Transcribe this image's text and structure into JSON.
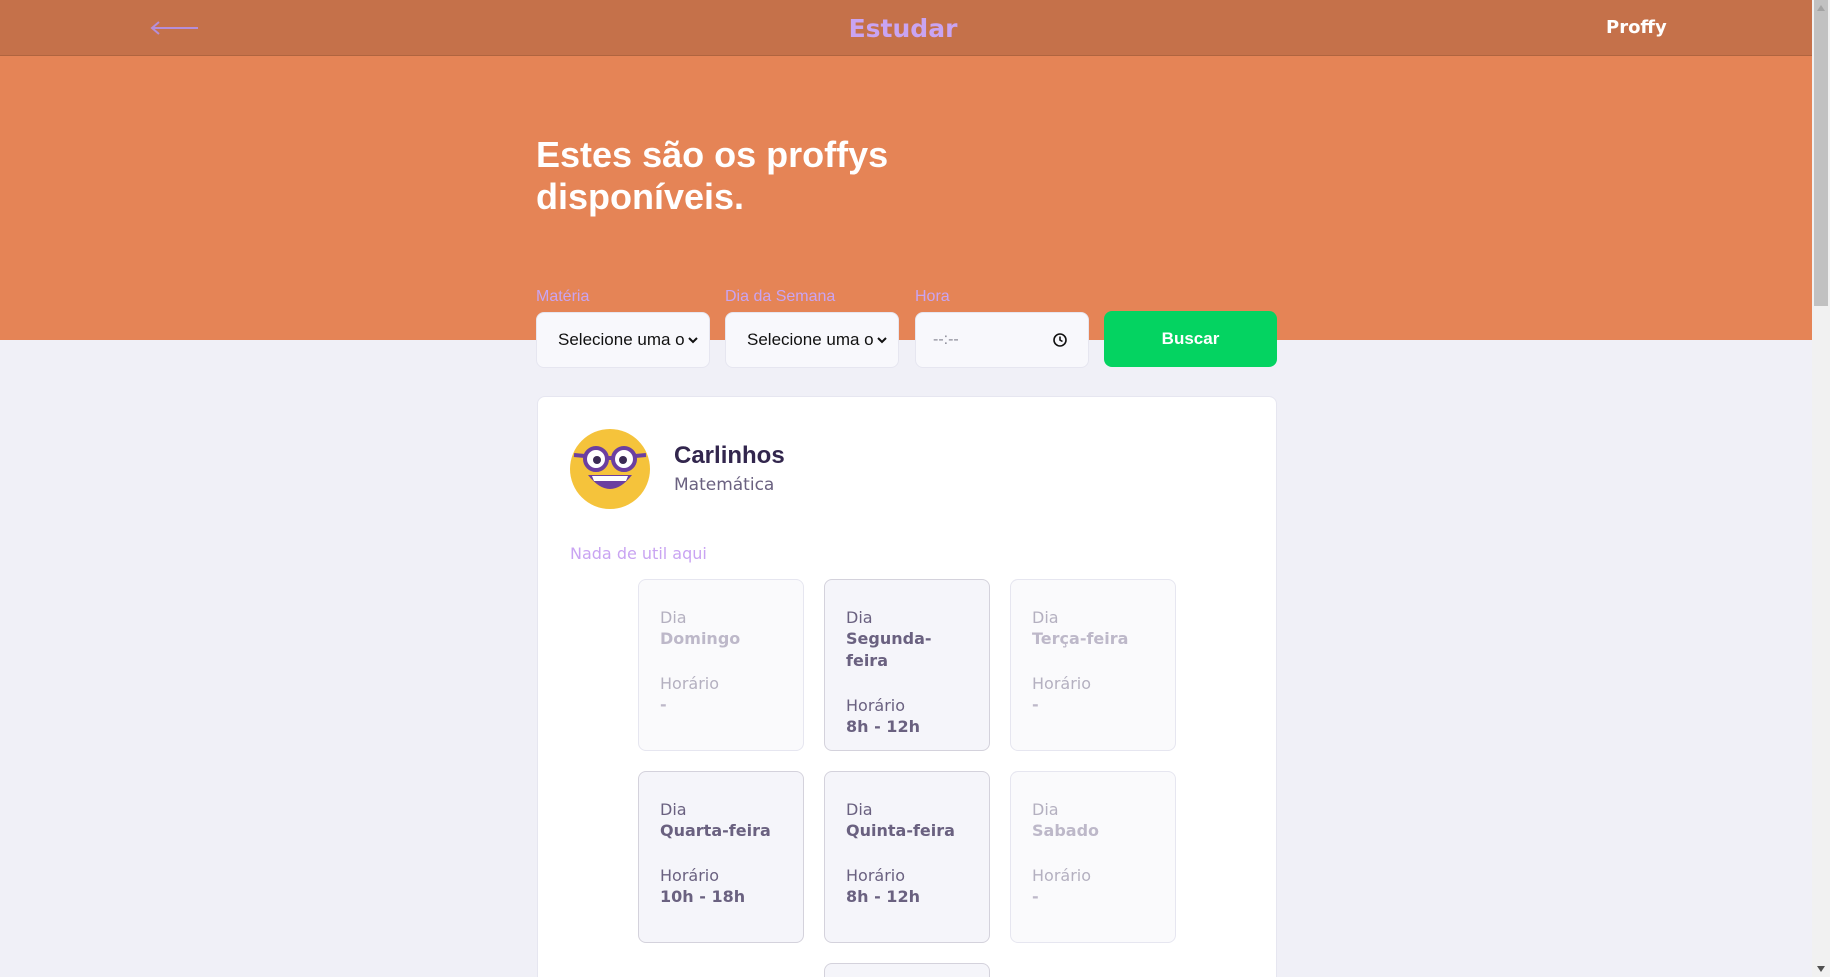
{
  "topbar": {
    "title": "Estudar",
    "brand": "Proffy",
    "back_icon": "arrow-left-icon"
  },
  "hero": {
    "title": "Estes são os proffys disponíveis."
  },
  "filters": {
    "subject_label": "Matéria",
    "subject_value": "Selecione uma o",
    "weekday_label": "Dia da Semana",
    "weekday_value": "Selecione uma o",
    "time_label": "Hora",
    "time_value": "--:--",
    "search_label": "Buscar"
  },
  "teacher": {
    "name": "Carlinhos",
    "subject": "Matemática",
    "bio": "Nada de util aqui",
    "avatar_icon": "nerd-face-icon"
  },
  "schedule_labels": {
    "day": "Dia",
    "time": "Horário"
  },
  "schedule": [
    {
      "day": "Domingo",
      "time": "-",
      "available": false
    },
    {
      "day": "Segunda-feira",
      "time": "8h - 12h",
      "available": true
    },
    {
      "day": "Terça-feira",
      "time": "-",
      "available": false
    },
    {
      "day": "Quarta-feira",
      "time": "10h - 18h",
      "available": true
    },
    {
      "day": "Quinta-feira",
      "time": "8h - 12h",
      "available": true
    },
    {
      "day": "Sabado",
      "time": "-",
      "available": false
    }
  ],
  "colors": {
    "topbar": "#c5714a",
    "hero": "#e58456",
    "accent": "#c9a4f2",
    "button": "#04d361",
    "text_title": "#32264d"
  }
}
